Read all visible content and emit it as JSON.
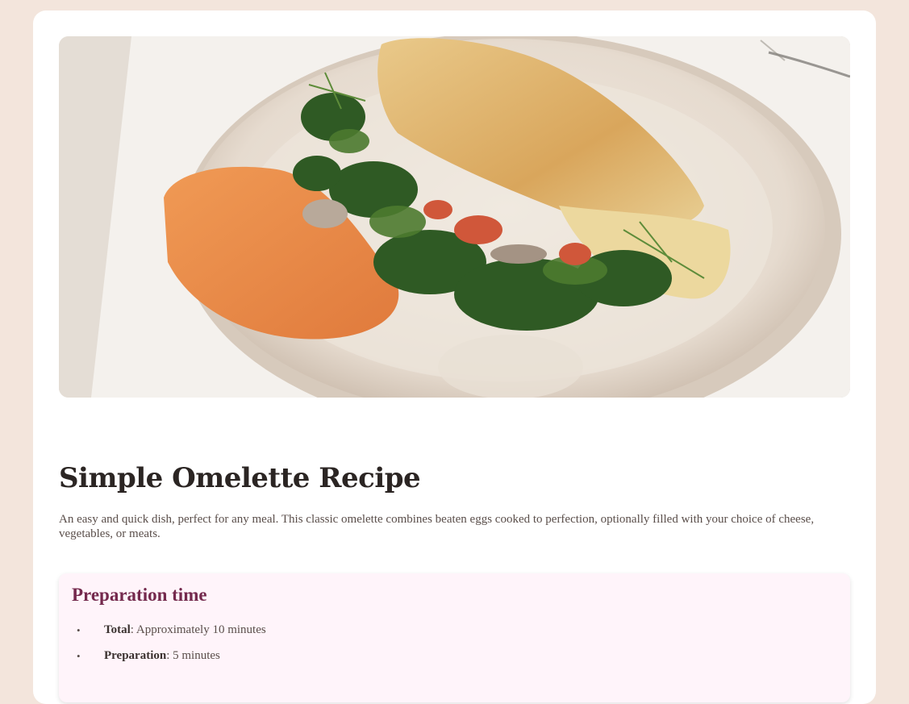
{
  "hero_image": {
    "icon": "omelette-photo"
  },
  "recipe": {
    "title": "Simple Omelette Recipe",
    "description": "An easy and quick dish, perfect for any meal. This classic omelette combines beaten eggs cooked to perfection, optionally filled with your choice of cheese, vegetables, or meats."
  },
  "preparation": {
    "heading": "Preparation time",
    "items": [
      {
        "label": "Total",
        "value": ": Approximately 10 minutes"
      },
      {
        "label": "Preparation",
        "value": ": 5 minutes"
      }
    ]
  },
  "colors": {
    "page_background": "#f3e5dc",
    "card_background": "#ffffff",
    "heading_accent": "#74294d",
    "prep_background": "#fff4fa"
  }
}
